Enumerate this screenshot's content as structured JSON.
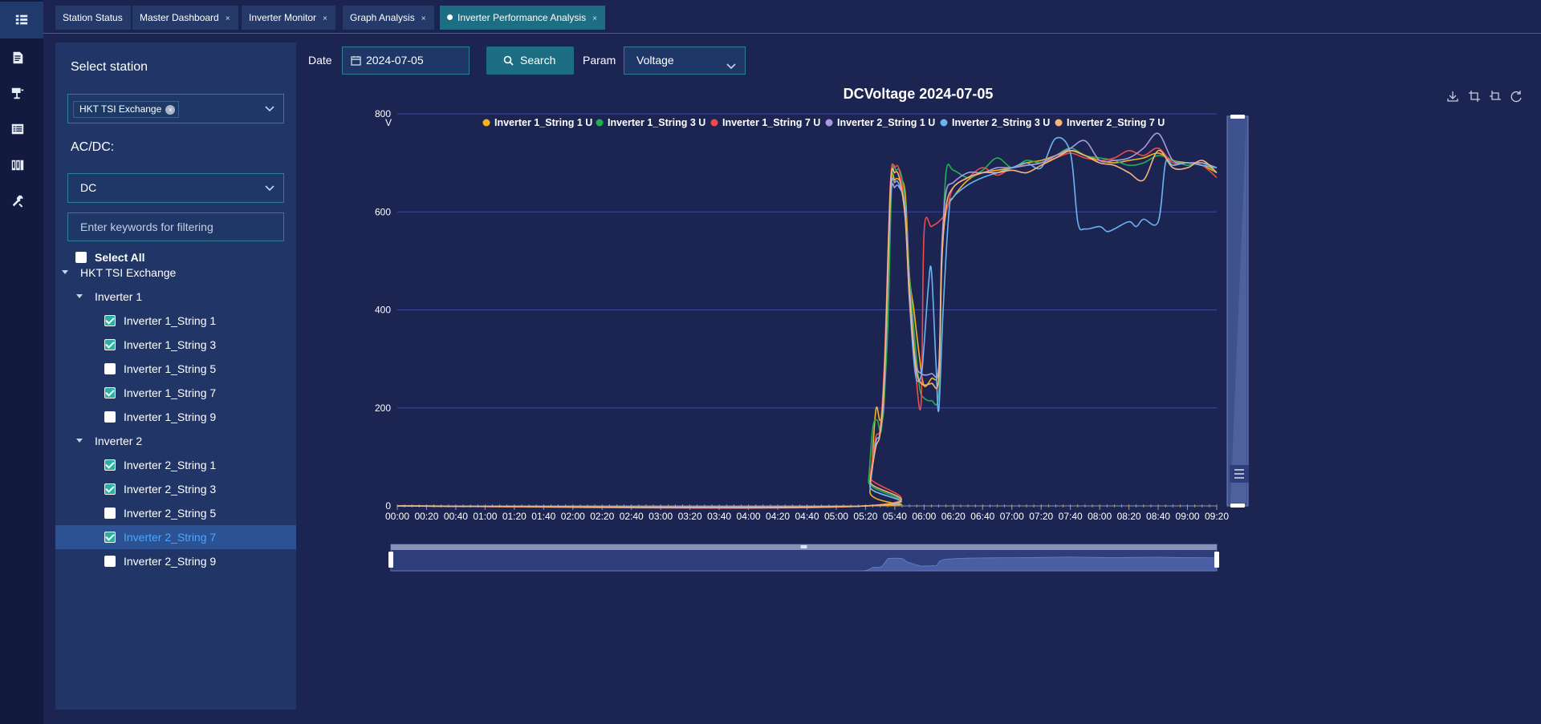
{
  "rail": {
    "icons": [
      "grid-icon",
      "document-icon",
      "solar-panel-icon",
      "list-icon",
      "library-icon",
      "tools-icon"
    ]
  },
  "tabs": [
    {
      "label": "Station Status",
      "closable": false,
      "active": false
    },
    {
      "label": "Master Dashboard",
      "closable": true,
      "active": false
    },
    {
      "label": "Inverter Monitor",
      "closable": true,
      "active": false
    },
    {
      "label": "Graph Analysis",
      "closable": true,
      "active": false
    },
    {
      "label": "Inverter Performance Analysis",
      "closable": true,
      "active": true
    }
  ],
  "tab_close": "×",
  "sidebar": {
    "select_station_label": "Select station",
    "station_tag": "HKT TSI Exchange",
    "station_tag_close": "×",
    "acdc_label": "AC/DC:",
    "acdc_value": "DC",
    "filter_placeholder": "Enter keywords for filtering",
    "select_all_label": "Select All",
    "tree": {
      "root": "HKT TSI Exchange",
      "groups": [
        {
          "name": "Inverter 1",
          "items": [
            {
              "label": "Inverter 1_String 1",
              "checked": true
            },
            {
              "label": "Inverter 1_String 3",
              "checked": true
            },
            {
              "label": "Inverter 1_String 5",
              "checked": false
            },
            {
              "label": "Inverter 1_String 7",
              "checked": true
            },
            {
              "label": "Inverter 1_String 9",
              "checked": false
            }
          ]
        },
        {
          "name": "Inverter 2",
          "items": [
            {
              "label": "Inverter 2_String 1",
              "checked": true
            },
            {
              "label": "Inverter 2_String 3",
              "checked": true
            },
            {
              "label": "Inverter 2_String 5",
              "checked": false
            },
            {
              "label": "Inverter 2_String 7",
              "checked": true,
              "highlighted": true
            },
            {
              "label": "Inverter 2_String 9",
              "checked": false
            }
          ]
        }
      ]
    }
  },
  "toolbar": {
    "date_label": "Date",
    "date_value": "2024-07-05",
    "search_label": "Search",
    "param_label": "Param",
    "param_value": "Voltage"
  },
  "chart_data": {
    "type": "line",
    "title": "DCVoltage 2024-07-05",
    "ylabel": "V",
    "xlabel": "",
    "ylim": [
      0,
      800
    ],
    "yticks": [
      0,
      200,
      400,
      600,
      800
    ],
    "grid": true,
    "legend_position": "top",
    "x_labels": [
      "00:00",
      "00:20",
      "00:40",
      "01:00",
      "01:20",
      "01:40",
      "02:00",
      "02:20",
      "02:40",
      "03:00",
      "03:20",
      "03:40",
      "04:00",
      "04:20",
      "04:40",
      "05:00",
      "05:20",
      "05:40",
      "06:00",
      "06:20",
      "06:40",
      "07:00",
      "07:20",
      "07:40",
      "08:00",
      "08:20",
      "08:40",
      "09:00",
      "09:20"
    ],
    "series": [
      {
        "name": "Inverter 1_String 1 U",
        "color": "#f5b418",
        "points": [
          [
            "00:00",
            0
          ],
          [
            "05:20",
            0
          ],
          [
            "05:23",
            30
          ],
          [
            "05:27",
            195
          ],
          [
            "05:30",
            175
          ],
          [
            "05:33",
            230
          ],
          [
            "05:37",
            640
          ],
          [
            "05:40",
            665
          ],
          [
            "05:43",
            665
          ],
          [
            "05:47",
            640
          ],
          [
            "05:50",
            470
          ],
          [
            "05:53",
            400
          ],
          [
            "05:57",
            300
          ],
          [
            "06:00",
            245
          ],
          [
            "06:05",
            260
          ],
          [
            "06:10",
            280
          ],
          [
            "06:12",
            500
          ],
          [
            "06:15",
            600
          ],
          [
            "06:20",
            630
          ],
          [
            "06:30",
            665
          ],
          [
            "06:40",
            680
          ],
          [
            "06:50",
            685
          ],
          [
            "07:00",
            690
          ],
          [
            "07:10",
            700
          ],
          [
            "07:20",
            705
          ],
          [
            "07:30",
            715
          ],
          [
            "07:40",
            725
          ],
          [
            "07:50",
            715
          ],
          [
            "08:00",
            705
          ],
          [
            "08:10",
            700
          ],
          [
            "08:20",
            705
          ],
          [
            "08:30",
            710
          ],
          [
            "08:40",
            720
          ],
          [
            "08:50",
            705
          ],
          [
            "09:00",
            700
          ],
          [
            "09:10",
            695
          ],
          [
            "09:20",
            680
          ]
        ]
      },
      {
        "name": "Inverter 1_String 3 U",
        "color": "#23b04f",
        "points": [
          [
            "00:00",
            0
          ],
          [
            "05:20",
            0
          ],
          [
            "05:22",
            50
          ],
          [
            "05:25",
            160
          ],
          [
            "05:28",
            175
          ],
          [
            "05:31",
            160
          ],
          [
            "05:35",
            350
          ],
          [
            "05:38",
            665
          ],
          [
            "05:41",
            685
          ],
          [
            "05:44",
            680
          ],
          [
            "05:47",
            620
          ],
          [
            "05:50",
            470
          ],
          [
            "05:54",
            330
          ],
          [
            "05:57",
            240
          ],
          [
            "06:00",
            220
          ],
          [
            "06:05",
            215
          ],
          [
            "06:10",
            230
          ],
          [
            "06:12",
            480
          ],
          [
            "06:15",
            680
          ],
          [
            "06:20",
            685
          ],
          [
            "06:30",
            670
          ],
          [
            "06:40",
            685
          ],
          [
            "06:50",
            710
          ],
          [
            "07:00",
            690
          ],
          [
            "07:10",
            705
          ],
          [
            "07:20",
            700
          ],
          [
            "07:30",
            715
          ],
          [
            "07:40",
            730
          ],
          [
            "07:50",
            715
          ],
          [
            "08:00",
            710
          ],
          [
            "08:10",
            705
          ],
          [
            "08:20",
            695
          ],
          [
            "08:30",
            700
          ],
          [
            "08:40",
            715
          ],
          [
            "08:50",
            705
          ],
          [
            "09:00",
            695
          ],
          [
            "09:10",
            700
          ],
          [
            "09:20",
            680
          ]
        ]
      },
      {
        "name": "Inverter 1_String 7 U",
        "color": "#ef4a4a",
        "points": [
          [
            "00:00",
            0
          ],
          [
            "05:20",
            0
          ],
          [
            "05:23",
            60
          ],
          [
            "05:27",
            140
          ],
          [
            "05:30",
            160
          ],
          [
            "05:33",
            300
          ],
          [
            "05:37",
            660
          ],
          [
            "05:40",
            690
          ],
          [
            "05:43",
            685
          ],
          [
            "05:47",
            600
          ],
          [
            "05:50",
            420
          ],
          [
            "05:54",
            280
          ],
          [
            "05:58",
            210
          ],
          [
            "06:00",
            560
          ],
          [
            "06:05",
            570
          ],
          [
            "06:10",
            580
          ],
          [
            "06:15",
            600
          ],
          [
            "06:20",
            650
          ],
          [
            "06:30",
            670
          ],
          [
            "06:40",
            690
          ],
          [
            "06:50",
            675
          ],
          [
            "07:00",
            690
          ],
          [
            "07:10",
            695
          ],
          [
            "07:20",
            700
          ],
          [
            "07:30",
            710
          ],
          [
            "07:40",
            720
          ],
          [
            "07:50",
            710
          ],
          [
            "08:00",
            705
          ],
          [
            "08:10",
            710
          ],
          [
            "08:20",
            725
          ],
          [
            "08:30",
            715
          ],
          [
            "08:40",
            730
          ],
          [
            "08:50",
            700
          ],
          [
            "09:00",
            700
          ],
          [
            "09:10",
            695
          ],
          [
            "09:20",
            670
          ]
        ]
      },
      {
        "name": "Inverter 2_String 1 U",
        "color": "#a99be0",
        "points": [
          [
            "00:00",
            0
          ],
          [
            "05:20",
            0
          ],
          [
            "05:23",
            40
          ],
          [
            "05:27",
            130
          ],
          [
            "05:30",
            150
          ],
          [
            "05:33",
            260
          ],
          [
            "05:37",
            620
          ],
          [
            "05:40",
            650
          ],
          [
            "05:43",
            650
          ],
          [
            "05:47",
            610
          ],
          [
            "05:50",
            450
          ],
          [
            "05:54",
            300
          ],
          [
            "05:58",
            270
          ],
          [
            "06:05",
            270
          ],
          [
            "06:10",
            285
          ],
          [
            "06:12",
            520
          ],
          [
            "06:15",
            640
          ],
          [
            "06:20",
            660
          ],
          [
            "06:30",
            680
          ],
          [
            "06:40",
            680
          ],
          [
            "06:50",
            690
          ],
          [
            "07:00",
            690
          ],
          [
            "07:10",
            695
          ],
          [
            "07:20",
            700
          ],
          [
            "07:30",
            715
          ],
          [
            "07:40",
            730
          ],
          [
            "07:50",
            745
          ],
          [
            "08:00",
            705
          ],
          [
            "08:10",
            705
          ],
          [
            "08:20",
            710
          ],
          [
            "08:30",
            730
          ],
          [
            "08:40",
            760
          ],
          [
            "08:50",
            705
          ],
          [
            "09:00",
            700
          ],
          [
            "09:10",
            700
          ],
          [
            "09:20",
            690
          ]
        ]
      },
      {
        "name": "Inverter 2_String 3 U",
        "color": "#6cb4f0",
        "points": [
          [
            "00:00",
            0
          ],
          [
            "05:20",
            0
          ],
          [
            "05:23",
            40
          ],
          [
            "05:27",
            130
          ],
          [
            "05:30",
            150
          ],
          [
            "05:33",
            260
          ],
          [
            "05:37",
            630
          ],
          [
            "05:40",
            660
          ],
          [
            "05:43",
            655
          ],
          [
            "05:47",
            600
          ],
          [
            "05:50",
            420
          ],
          [
            "05:54",
            270
          ],
          [
            "05:58",
            265
          ],
          [
            "06:00",
            330
          ],
          [
            "06:03",
            450
          ],
          [
            "06:05",
            480
          ],
          [
            "06:08",
            300
          ],
          [
            "06:10",
            195
          ],
          [
            "06:13",
            400
          ],
          [
            "06:17",
            600
          ],
          [
            "06:20",
            630
          ],
          [
            "06:30",
            655
          ],
          [
            "06:40",
            670
          ],
          [
            "06:50",
            680
          ],
          [
            "07:00",
            690
          ],
          [
            "07:10",
            700
          ],
          [
            "07:20",
            690
          ],
          [
            "07:30",
            750
          ],
          [
            "07:40",
            720
          ],
          [
            "07:45",
            580
          ],
          [
            "07:50",
            565
          ],
          [
            "08:00",
            570
          ],
          [
            "08:05",
            560
          ],
          [
            "08:10",
            565
          ],
          [
            "08:20",
            580
          ],
          [
            "08:25",
            570
          ],
          [
            "08:30",
            585
          ],
          [
            "08:40",
            580
          ],
          [
            "08:45",
            700
          ],
          [
            "08:50",
            695
          ],
          [
            "09:00",
            700
          ],
          [
            "09:10",
            695
          ],
          [
            "09:20",
            690
          ]
        ]
      },
      {
        "name": "Inverter 2_String 7 U",
        "color": "#f6b37a",
        "points": [
          [
            "00:00",
            0
          ],
          [
            "05:20",
            0
          ],
          [
            "05:23",
            50
          ],
          [
            "05:27",
            120
          ],
          [
            "05:30",
            150
          ],
          [
            "05:33",
            280
          ],
          [
            "05:37",
            650
          ],
          [
            "05:40",
            680
          ],
          [
            "05:43",
            670
          ],
          [
            "05:47",
            590
          ],
          [
            "05:50",
            430
          ],
          [
            "05:54",
            290
          ],
          [
            "05:58",
            250
          ],
          [
            "06:05",
            250
          ],
          [
            "06:10",
            260
          ],
          [
            "06:12",
            490
          ],
          [
            "06:15",
            610
          ],
          [
            "06:20",
            650
          ],
          [
            "06:30",
            670
          ],
          [
            "06:40",
            680
          ],
          [
            "06:50",
            680
          ],
          [
            "07:00",
            685
          ],
          [
            "07:10",
            680
          ],
          [
            "07:20",
            695
          ],
          [
            "07:30",
            710
          ],
          [
            "07:40",
            725
          ],
          [
            "07:50",
            715
          ],
          [
            "08:00",
            700
          ],
          [
            "08:10",
            695
          ],
          [
            "08:20",
            680
          ],
          [
            "08:30",
            665
          ],
          [
            "08:40",
            725
          ],
          [
            "08:50",
            690
          ],
          [
            "09:00",
            690
          ],
          [
            "09:10",
            705
          ],
          [
            "09:20",
            680
          ]
        ]
      }
    ],
    "zoom_start": "00:00",
    "zoom_end": "09:20"
  }
}
